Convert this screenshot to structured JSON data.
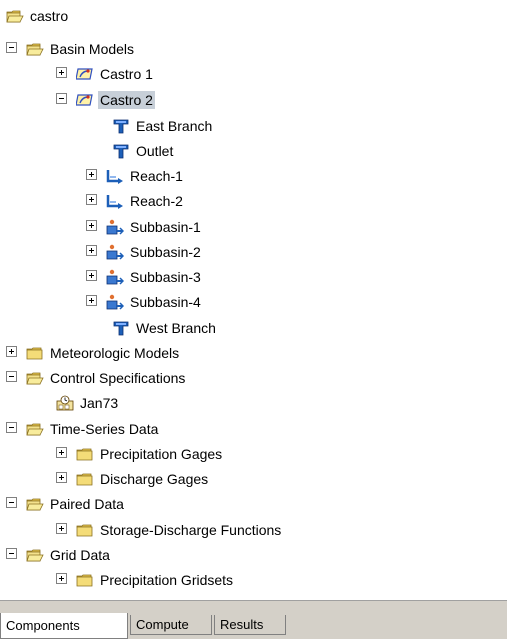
{
  "tree": {
    "root": "castro",
    "basin_models": "Basin Models",
    "castro1": "Castro 1",
    "castro2": "Castro 2",
    "east_branch": "East Branch",
    "outlet": "Outlet",
    "reach1": "Reach-1",
    "reach2": "Reach-2",
    "subbasin1": "Subbasin-1",
    "subbasin2": "Subbasin-2",
    "subbasin3": "Subbasin-3",
    "subbasin4": "Subbasin-4",
    "west_branch": "West Branch",
    "meteorologic_models": "Meteorologic Models",
    "control_specifications": "Control Specifications",
    "jan73": "Jan73",
    "time_series_data": "Time-Series Data",
    "precipitation_gages": "Precipitation Gages",
    "discharge_gages": "Discharge Gages",
    "paired_data": "Paired Data",
    "storage_discharge": "Storage-Discharge Functions",
    "grid_data": "Grid Data",
    "precipitation_gridsets": "Precipitation Gridsets"
  },
  "tabs": {
    "components": "Components",
    "compute": "Compute",
    "results": "Results"
  },
  "icons": {
    "folder_open": "folder-open-icon",
    "folder_closed": "folder-icon",
    "basin_model": "basin-model-icon",
    "junction": "junction-icon",
    "reach": "reach-icon",
    "subbasin": "subbasin-icon",
    "control_spec": "calendar-clock-icon"
  },
  "colors": {
    "folder": "#f0d870",
    "selection": "#c7cfd8",
    "junction": "#1c5fb8",
    "tabbar": "#d4d0c8"
  }
}
